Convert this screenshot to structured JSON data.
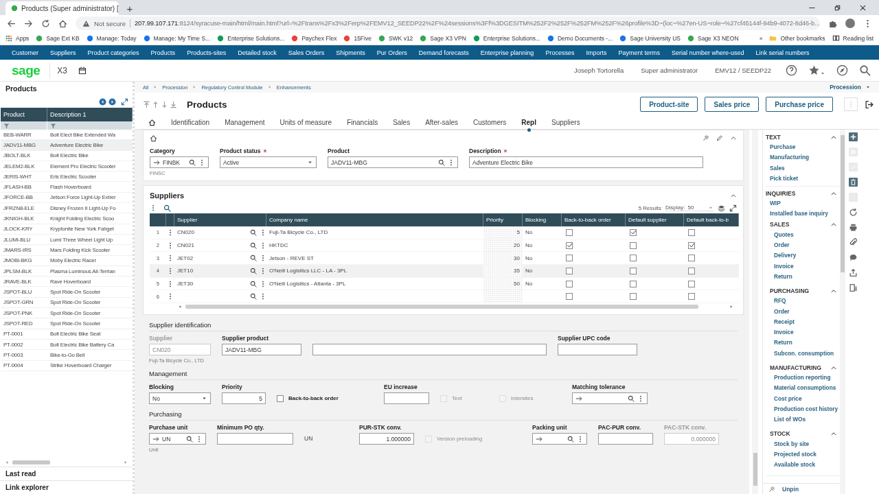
{
  "browser": {
    "tab_title": "Products (Super administrator) [",
    "new_tab": "+",
    "security": "Not secure",
    "url_host": "207.99.107.171",
    "url_path": ":8124/syracuse-main/html/main.html?url=%2Ftrans%2Fx3%2Ferp%2FEMV12_SEEDP22%2F%24sessions%3Ff%3DGESITM%252F2%252F%252FM%252F%26profile%3D~(loc~%27en-US~role~%27cf45144f-94b9-4072-8d46-b...",
    "bookmarks": [
      "Apps",
      "Sage Ext KB",
      "Manage: Today",
      "Manage: My Time S...",
      "Enterprise Solutions...",
      "Paychex Flex",
      "15Five",
      "SWK v12",
      "Sage X3 VPN",
      "Enterprise Solutions...",
      "Demo Documents -...",
      "Sage University US",
      "Sage X3 NEON"
    ],
    "more": "»",
    "other_bookmarks": "Other bookmarks",
    "reading_list": "Reading list"
  },
  "nav_menu": [
    "Customer",
    "Suppliers",
    "Product categories",
    "Products",
    "Products-sites",
    "Detailed stock",
    "Sales Orders",
    "Shipments",
    "Pur Orders",
    "Demand forecasts",
    "Enterprise planning",
    "Processes",
    "Imports",
    "Payment terms",
    "Serial number where-used",
    "Link serial numbers"
  ],
  "app_header": {
    "logo": "sage",
    "product": "X3",
    "user": "Joseph Tortorella",
    "role": "Super administrator",
    "folder": "EMV12 / SEEDP22"
  },
  "left_panel": {
    "title": "Products",
    "columns": [
      "Product",
      "Description 1"
    ],
    "rows": [
      {
        "product": "BEB-WARR",
        "description": "Bolt Elect Bike Extended Wa",
        "selected": false
      },
      {
        "product": "JADV11-MBG",
        "description": "Adventure Electric Bike",
        "selected": true
      },
      {
        "product": "JBOLT-BLK",
        "description": "Bolt Electric Bike",
        "selected": false
      },
      {
        "product": "JELEM2-BLK",
        "description": "Element Pro Electric Scooter",
        "selected": false
      },
      {
        "product": "JERIS-WHT",
        "description": "Eris Electric Scooter",
        "selected": false
      },
      {
        "product": "JFLASH-BB",
        "description": "Flash Hoverboard",
        "selected": false
      },
      {
        "product": "JFORCE-BB",
        "description": "Jetson Force Light-Up Extrer",
        "selected": false
      },
      {
        "product": "JFRZN8-ELE",
        "description": "Disney Frozen II Light-Up Fo",
        "selected": false
      },
      {
        "product": "JKNIGH-BLK",
        "description": "Knight Folding Electric Scoo",
        "selected": false
      },
      {
        "product": "JLOCK-KRY",
        "description": "Kryptonite New York Fahget",
        "selected": false
      },
      {
        "product": "JLUMI-BLU",
        "description": "Lumi Three Wheel Light Up",
        "selected": false
      },
      {
        "product": "JMARS-IRS",
        "description": "Mars Folding Kick Scooter",
        "selected": false
      },
      {
        "product": "JMOBI-BKG",
        "description": "Moby Electric Racer",
        "selected": false
      },
      {
        "product": "JPLSM-BLK",
        "description": "Plasma Luminous All-Terrian",
        "selected": false
      },
      {
        "product": "JRAVE-BLK",
        "description": "Rave Hoverboard",
        "selected": false
      },
      {
        "product": "JSPOT-BLU",
        "description": "Spot Ride-On Scooter",
        "selected": false
      },
      {
        "product": "JSPOT-GRN",
        "description": "Spot Ride-On Scooter",
        "selected": false
      },
      {
        "product": "JSPOT-PNK",
        "description": "Spot Ride-On Scooter",
        "selected": false
      },
      {
        "product": "JSPOT-RED",
        "description": "Spot Ride-On Scooter",
        "selected": false
      },
      {
        "product": "PT-0001",
        "description": "Bolt Electric Bike Seat",
        "selected": false
      },
      {
        "product": "PT-0002",
        "description": "Bolt Electric Bike Battery Ca",
        "selected": false
      },
      {
        "product": "PT-0003",
        "description": "Bike-to-Go Bell",
        "selected": false
      },
      {
        "product": "PT-0004",
        "description": "Strike Hoverboard Charger",
        "selected": false
      }
    ],
    "sections": [
      "Last read",
      "Link explorer"
    ]
  },
  "breadcrumb": [
    "All",
    "Procession",
    "Regulatory Control Module",
    "Enhancements"
  ],
  "endpoint": "Procession",
  "page_title": "Products",
  "action_buttons": [
    "Product-site",
    "Sales price",
    "Purchase price"
  ],
  "tabs": [
    {
      "label": "Identification",
      "selected": false
    },
    {
      "label": "Management",
      "selected": false
    },
    {
      "label": "Units of measure",
      "selected": false
    },
    {
      "label": "Financials",
      "selected": false
    },
    {
      "label": "Sales",
      "selected": false
    },
    {
      "label": "After-sales",
      "selected": false
    },
    {
      "label": "Customers",
      "selected": false
    },
    {
      "label": "Repl",
      "selected": true
    },
    {
      "label": "Suppliers",
      "selected": false
    }
  ],
  "header_fields": [
    {
      "label": "Category",
      "required": false,
      "kind": "reference",
      "value": "FINBK",
      "note": "FINSC"
    },
    {
      "label": "Product status",
      "required": true,
      "kind": "select",
      "value": "Active"
    },
    {
      "label": "Product",
      "required": false,
      "kind": "lookup",
      "value": "JADV11-MBG"
    },
    {
      "label": "Description",
      "required": true,
      "kind": "text",
      "value": "Adventure Electric Bike"
    }
  ],
  "suppliers": {
    "title": "Suppliers",
    "results": "5 Results",
    "display_label": "Display:",
    "display_value": "50",
    "columns": [
      "Supplier",
      "Company name",
      "Priority",
      "Blocking",
      "Back-to-back order",
      "Default supplier",
      "Default back-to-b"
    ],
    "rows": [
      {
        "line": "1",
        "supplier": "CN020",
        "company": "Fuji-Ta Bicycle Co., LTD",
        "priority": "5",
        "blocking": "No",
        "back_to_back": false,
        "default_supplier": true,
        "default_back_to_back": false,
        "selected": false
      },
      {
        "line": "2",
        "supplier": "CN021",
        "company": "HKTDC",
        "priority": "20",
        "blocking": "No",
        "back_to_back": true,
        "default_supplier": false,
        "default_back_to_back": true,
        "selected": false
      },
      {
        "line": "3",
        "supplier": "JET02",
        "company": "Jetson - REVE ST",
        "priority": "30",
        "blocking": "No",
        "back_to_back": false,
        "default_supplier": false,
        "default_back_to_back": false,
        "selected": false
      },
      {
        "line": "4",
        "supplier": "JET10",
        "company": "O'Neill Logisitics LLC - LA - 3PL",
        "priority": "35",
        "blocking": "No",
        "back_to_back": false,
        "default_supplier": false,
        "default_back_to_back": false,
        "selected": true
      },
      {
        "line": "5",
        "supplier": "JET30",
        "company": "O'Neill Logisitics - Atlanta - 3PL",
        "priority": "50",
        "blocking": "No",
        "back_to_back": false,
        "default_supplier": false,
        "default_back_to_back": false,
        "selected": false
      },
      {
        "line": "6",
        "back_to_back": false,
        "default_supplier": false,
        "default_back_to_back": false,
        "selected": false
      }
    ]
  },
  "form_sections": [
    {
      "title": "Supplier identification",
      "fields": [
        {
          "label": "Supplier",
          "kind": "text",
          "value": "CN020",
          "disabled": true,
          "note": "Fuji-Ta Bicycle Co., LTD"
        },
        {
          "label": "Supplier product",
          "kind": "text",
          "value": "JADV11-MBG",
          "disabled": false
        },
        {
          "kind": "wide",
          "disabled": false
        },
        {
          "label": "Supplier UPC code",
          "kind": "text",
          "disabled": false
        }
      ]
    },
    {
      "title": "Management",
      "fields": [
        {
          "label": "Blocking",
          "kind": "select",
          "value": "No",
          "disabled": false
        },
        {
          "label": "Priority",
          "kind": "number",
          "value": "5",
          "disabled": false
        },
        {
          "label": "Back-to-back order",
          "kind": "checkbox",
          "checked": false,
          "disabled": false
        },
        {
          "label": "EU increase",
          "kind": "text",
          "disabled": false
        },
        {
          "label": "Text",
          "kind": "checkbox",
          "checked": false,
          "disabled": true
        },
        {
          "label": "Intersites",
          "kind": "checkbox",
          "checked": false,
          "disabled": true
        },
        {
          "label": "Matching tolerance",
          "kind": "reference",
          "disabled": false
        }
      ]
    },
    {
      "title": "Purchasing",
      "fields": [
        {
          "label": "Purchase unit",
          "kind": "reference",
          "value": "UN",
          "disabled": false,
          "note": "Unit"
        },
        {
          "label": "Minimum PO qty.",
          "kind": "text",
          "disabled": false
        },
        {
          "kind": "unit",
          "value": "UN",
          "disabled": false
        },
        {
          "label": "PUR-STK conv.",
          "kind": "number",
          "value": "1.000000",
          "disabled": false
        },
        {
          "label": "Version preloading",
          "kind": "checkbox",
          "checked": false,
          "disabled": true
        },
        {
          "label": "Packing unit",
          "kind": "reference",
          "disabled": false
        },
        {
          "label": "PAC-PUR conv.",
          "kind": "text",
          "disabled": false
        },
        {
          "label": "PAC-STK conv.",
          "kind": "number",
          "value": "0.000000",
          "disabled": true
        }
      ]
    }
  ],
  "side_menu": [
    {
      "title": "TEXT",
      "expanded": true,
      "items": [
        "Purchase",
        "Manufacturing",
        "Sales",
        "Pick ticket"
      ]
    },
    {
      "title": "INQUIRIES",
      "expanded": true,
      "items": [
        "WIP",
        "Installed base inquiry"
      ],
      "children": [
        {
          "title": "SALES",
          "expanded": true,
          "items": [
            "Quotes",
            "Order",
            "Delivery",
            "Invoice",
            "Return"
          ]
        },
        {
          "title": "PURCHASING",
          "expanded": true,
          "items": [
            "RFQ",
            "Order",
            "Receipt",
            "Invoice",
            "Return",
            "Subcon. consumption"
          ]
        },
        {
          "title": "MANUFACTURING",
          "expanded": true,
          "items": [
            "Production reporting",
            "Material consumptions",
            "Cost price",
            "Production cost history",
            "List of WOs"
          ]
        },
        {
          "title": "STOCK",
          "expanded": true,
          "items": [
            "Stock by site",
            "Projected stock",
            "Available stock"
          ]
        }
      ]
    }
  ],
  "side_footer": "Unpin"
}
